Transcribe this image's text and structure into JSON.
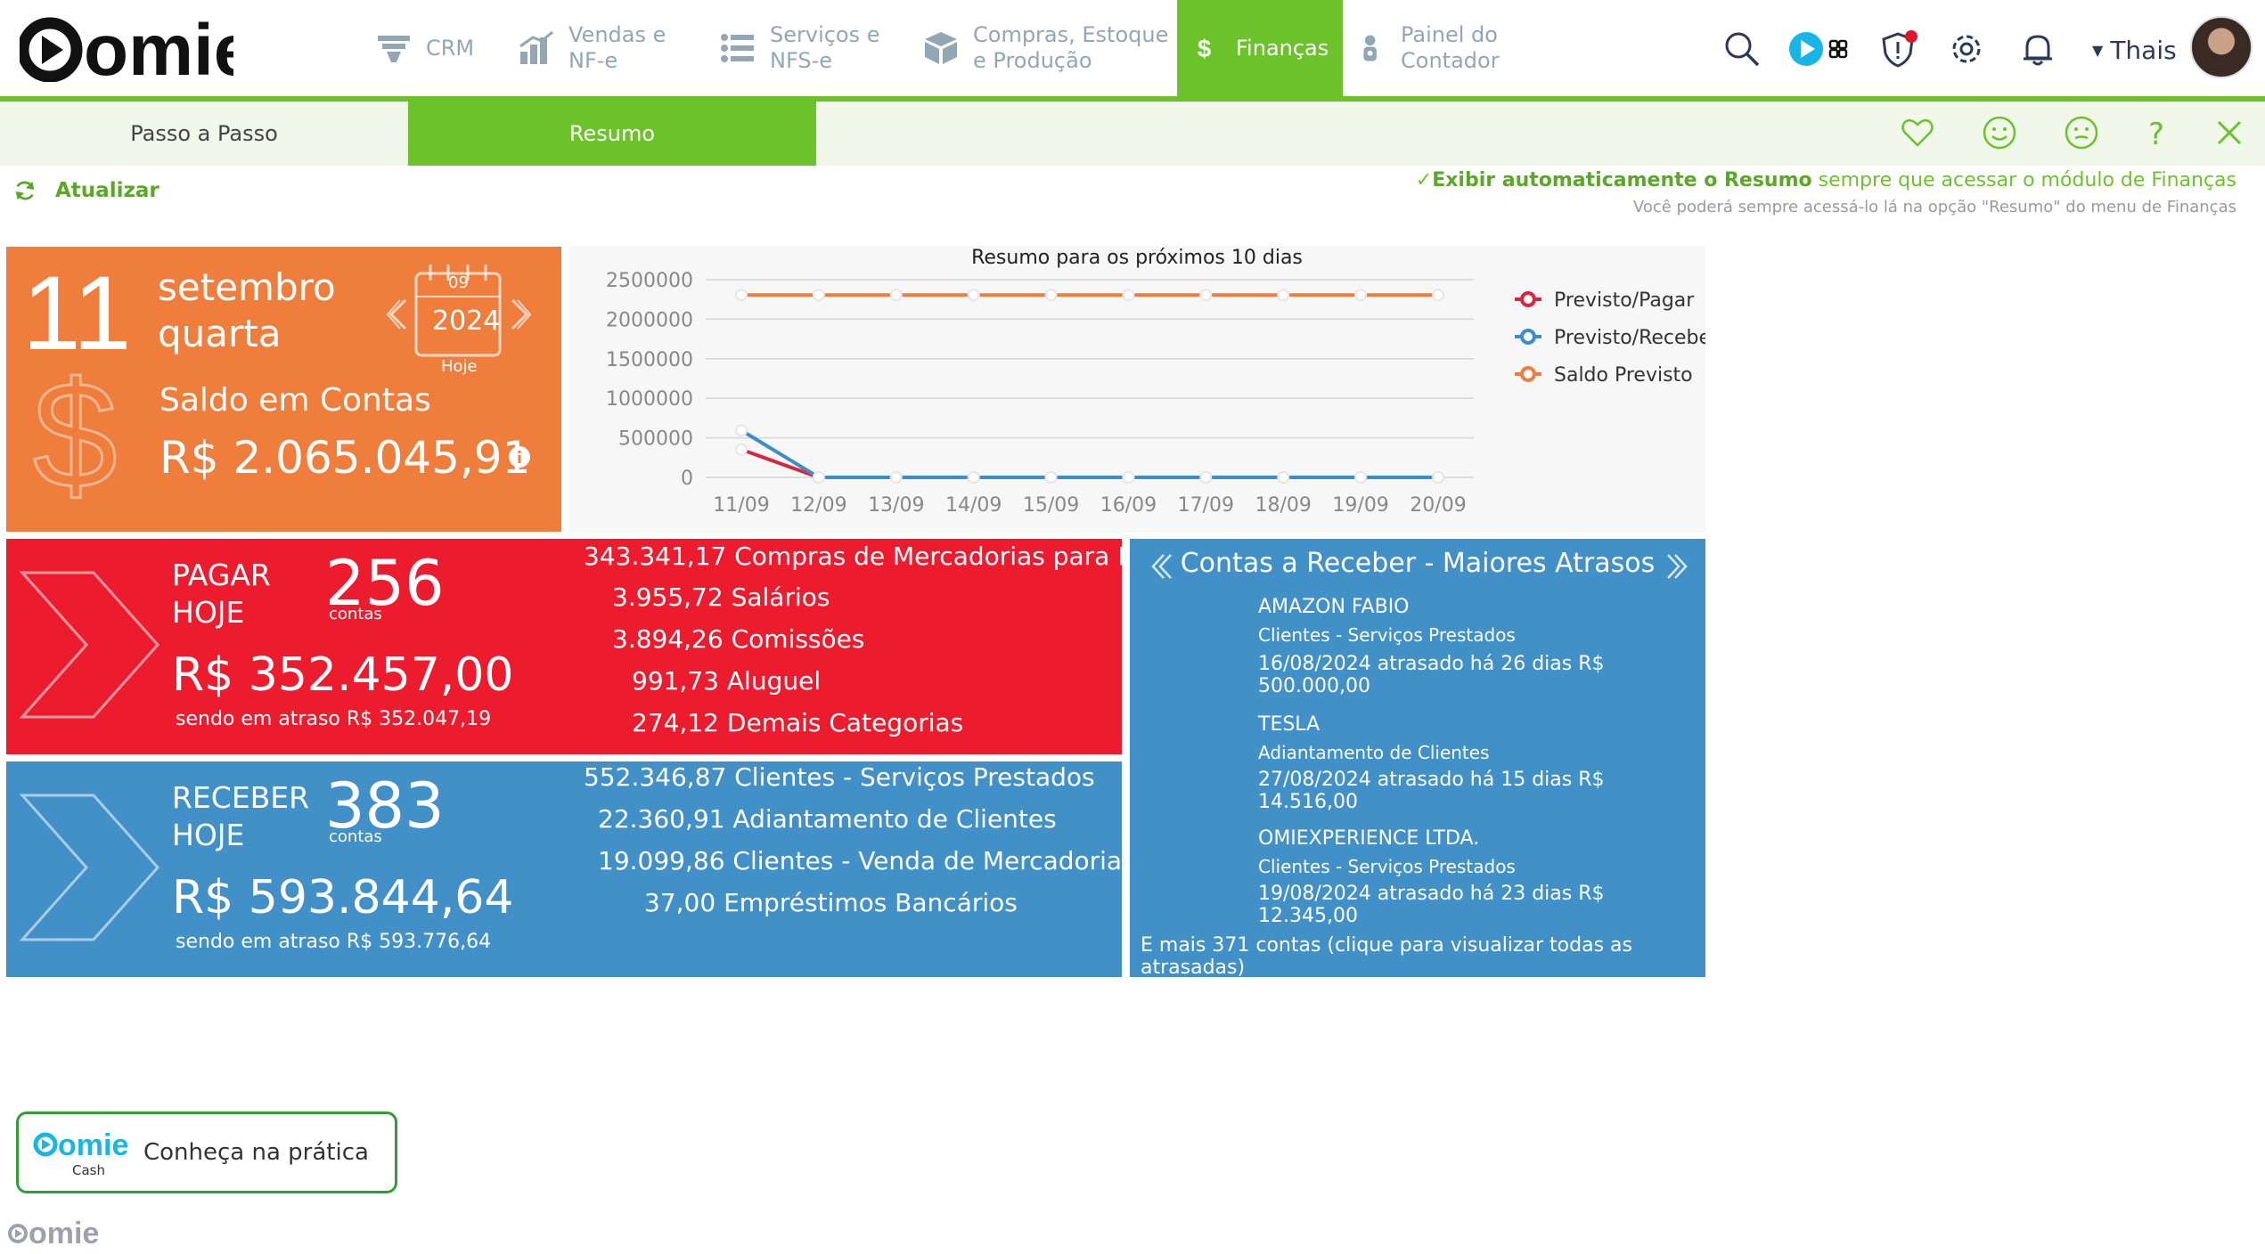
{
  "brand": {
    "logo_text": "omie",
    "accent": "#6cc22b",
    "orange": "#ef7d3c",
    "red": "#ec1b2e",
    "blue": "#4190c8"
  },
  "nav": {
    "items": [
      {
        "label_1": "CRM",
        "label_2": "",
        "icon": "funnel-icon"
      },
      {
        "label_1": "Vendas e",
        "label_2": "NF-e",
        "icon": "bar-chart-icon"
      },
      {
        "label_1": "Serviços e",
        "label_2": "NFS-e",
        "icon": "list-icon"
      },
      {
        "label_1": "Compras, Estoque",
        "label_2": "e Produção",
        "icon": "box-icon"
      },
      {
        "label_1": "Finanças",
        "label_2": "",
        "icon": "dollar-icon"
      },
      {
        "label_1": "Painel do",
        "label_2": "Contador",
        "icon": "person-icon"
      }
    ],
    "user_name": "Thais"
  },
  "tabs": {
    "step": "Passo a Passo",
    "summary": "Resumo"
  },
  "refresh_label": "Atualizar",
  "auto_show": {
    "bold": "Exibir automaticamente o Resumo",
    "rest": " sempre que acessar o módulo de Finanças",
    "sub": "Você poderá sempre acessá-lo lá na opção \"Resumo\" do menu de Finanças"
  },
  "date_card": {
    "day": "11",
    "month": "setembro",
    "weekday": "quarta",
    "cal_month": "09",
    "cal_year": "2024",
    "cal_today": "Hoje",
    "saldo_label": "Saldo em Contas",
    "saldo_value": "R$ 2.065.045,91"
  },
  "chart_data": {
    "type": "line",
    "title": "Resumo para os próximos 10 dias",
    "categories": [
      "11/09",
      "12/09",
      "13/09",
      "14/09",
      "15/09",
      "16/09",
      "17/09",
      "18/09",
      "19/09",
      "20/09"
    ],
    "y_ticks": [
      "2500000",
      "2000000",
      "1500000",
      "1000000",
      "500000",
      "0"
    ],
    "ylim": [
      0,
      2500000
    ],
    "legend_position": "right",
    "series": [
      {
        "name": "Previsto/Pagar",
        "color": "#d7263d",
        "values": [
          352457,
          0,
          0,
          0,
          0,
          0,
          0,
          0,
          0,
          0
        ]
      },
      {
        "name": "Previsto/Receber",
        "color": "#3b8ec6",
        "values": [
          593844,
          0,
          0,
          0,
          0,
          0,
          0,
          0,
          0,
          0
        ]
      },
      {
        "name": "Saldo Previsto",
        "color": "#ef7d3c",
        "values": [
          2306000,
          2306000,
          2306000,
          2306000,
          2306000,
          2306000,
          2306000,
          2306000,
          2306000,
          2306000
        ]
      }
    ]
  },
  "pagar": {
    "kind_1": "PAGAR",
    "kind_2": "HOJE",
    "count": "256",
    "count_label": "contas",
    "total": "R$ 352.457,00",
    "overdue": "sendo em atraso R$ 352.047,19",
    "categories": [
      {
        "value": "343.341,17",
        "name": "Compras de Mercadorias para Rever"
      },
      {
        "value": "3.955,72",
        "name": "Salários"
      },
      {
        "value": "3.894,26",
        "name": "Comissões"
      },
      {
        "value": "991,73",
        "name": "Aluguel"
      },
      {
        "value": "274,12",
        "name": "Demais Categorias"
      }
    ]
  },
  "receber": {
    "kind_1": "RECEBER",
    "kind_2": "HOJE",
    "count": "383",
    "count_label": "contas",
    "total": "R$ 593.844,64",
    "overdue": "sendo em atraso R$ 593.776,64",
    "categories": [
      {
        "value": "552.346,87",
        "name": "Clientes - Serviços Prestados"
      },
      {
        "value": "22.360,91",
        "name": "Adiantamento de Clientes"
      },
      {
        "value": "19.099,86",
        "name": "Clientes - Venda de Mercadoria Fa"
      },
      {
        "value": "37,00",
        "name": "Empréstimos Bancários"
      }
    ]
  },
  "atrasos": {
    "title": "Contas a Receber - Maiores Atrasos",
    "items": [
      {
        "name": "AMAZON FABIO",
        "category": "Clientes - Serviços Prestados",
        "detail": "16/08/2024 atrasado há 26 dias R$ 500.000,00"
      },
      {
        "name": "TESLA",
        "category": "Adiantamento de Clientes",
        "detail": "27/08/2024 atrasado há 15 dias R$ 14.516,00"
      },
      {
        "name": "OMIEXPERIENCE LTDA.",
        "category": "Clientes - Serviços Prestados",
        "detail": "19/08/2024 atrasado há 23 dias R$ 12.345,00"
      }
    ],
    "more": "E mais 371 contas (clique para visualizar todas as atrasadas)"
  },
  "cash": {
    "logo_text": "omie",
    "logo_sub": "Cash",
    "label": "Conheça na prática"
  },
  "footer_logo_text": "omie"
}
